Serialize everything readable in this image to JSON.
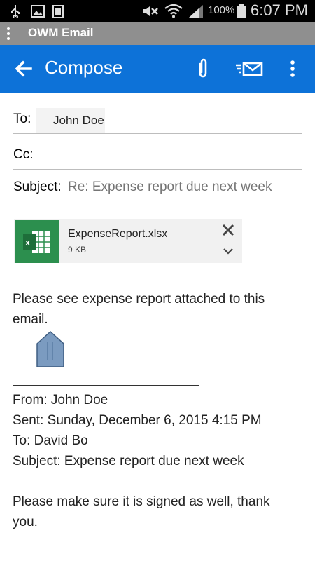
{
  "status_bar": {
    "battery_percent": "100%",
    "time": "6:07 PM",
    "icons": [
      "usb-icon",
      "image-icon",
      "battery-100-icon",
      "mute-icon",
      "wifi-icon",
      "signal-icon",
      "battery-icon"
    ]
  },
  "app_bar": {
    "name": "OWM Email"
  },
  "toolbar": {
    "title": "Compose",
    "icons": [
      "back-arrow-icon",
      "attach-icon",
      "send-icon",
      "overflow-menu-icon"
    ],
    "accent": "#0d72d8"
  },
  "form": {
    "to_label": "To:",
    "to_recipient": "John Doe",
    "cc_label": "Cc:",
    "subject_label": "Subject:",
    "subject_value": "Re: Expense report due next week"
  },
  "attachment": {
    "filename": "ExpenseReport.xlsx",
    "size": "9 KB",
    "icon": "excel-icon"
  },
  "message": {
    "line1": "Please see expense report attached to this",
    "line2": "email."
  },
  "quoted": {
    "from": "From: John Doe",
    "sent": "Sent: Sunday, December 6, 2015 4:15 PM",
    "to": "To: David Bo",
    "subject": "Subject: Expense report due next week",
    "body_line1": "Please make sure it is signed as well, thank",
    "body_line2": "you."
  }
}
